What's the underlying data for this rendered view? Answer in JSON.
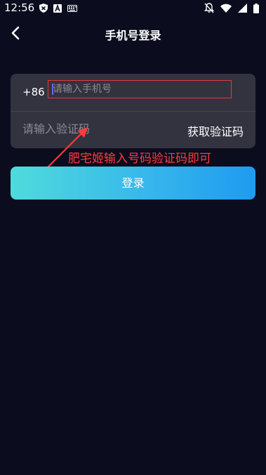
{
  "status_bar": {
    "time": "12:56",
    "icons": [
      "shield-icon",
      "a-icon",
      "keyboard-icon",
      "bell-off-icon",
      "wifi-icon",
      "signal-icon",
      "battery-icon"
    ]
  },
  "header": {
    "title": "手机号登录",
    "back_icon": "chevron-left-icon"
  },
  "form": {
    "country_code": "+86",
    "phone_placeholder": "请输入手机号",
    "phone_value": "",
    "code_placeholder": "请输入验证码",
    "code_value": "",
    "get_code_label": "获取验证码"
  },
  "annotation": {
    "text": "肥宅姬输入号码验证码即可",
    "color": "#ff3b3b"
  },
  "login_button": {
    "label": "登录",
    "gradient_start": "#4fdbdc",
    "gradient_end": "#1e9bf0"
  },
  "colors": {
    "background": "#0b0c1d",
    "card": "#33333f"
  }
}
